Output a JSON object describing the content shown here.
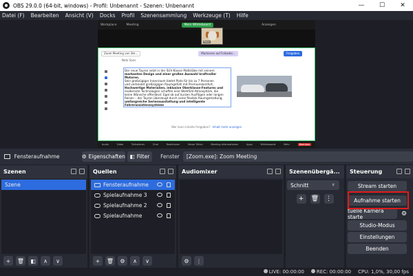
{
  "window": {
    "title": "OBS 29.0.0 (64-bit, windows) - Profil: Unbenannt - Szenen: Unbenannt",
    "minimize": "—",
    "maximize": "☐",
    "close": "✕"
  },
  "menu": [
    "Datei (F)",
    "Bearbeiten",
    "Ansicht (V)",
    "Docks",
    "Profil",
    "Szenensammlung",
    "Werkzeuge (T)",
    "Hilfe"
  ],
  "preview": {
    "zoom_tabs": [
      "Workplace",
      "Meeting",
      "Mein Whiteboard",
      "Anzeigen"
    ],
    "camera_name": "Peter",
    "whiteboard": {
      "title_input": "Zoom Meeting von Ste...",
      "follow_button": "Markieren auf Folkader...",
      "share_button": "Freigeben",
      "font": "Noto Sans",
      "text_lines": [
        "Der neue Tayron setzt in der SUV-Klasse Maßstäbe mit seinem",
        "markanten Design und einer großen Auswahl kraftvoller Motoren.",
        "Sein großzügiger Innenraum bietet Platz für bis zu 7 Personen",
        "und verbindet großzügigen Raumgefühl mit Premiumkomfort,",
        "Hochwertige Materialien, inklusive Oberklasse-Features und",
        "modernste Technologien schaffen eine Wohlfühl-Atmosphäre, die",
        "keine Wünsche offenlässt. Egal ob auf kurzen Ausflügen oder langen",
        "Reisen – der Tayron überzeugt durch seine flexible Raumgestaltung,",
        "umfangreiche Serienausstattung und intelligente",
        "Fahrerassistenzsysteme"
      ],
      "hint": "Wer kann Inhalte freigeben?",
      "hint_link": "Inhalt mehr anzeigen"
    },
    "zoom_controls": [
      "Audio",
      "Video",
      "Teilnehmer",
      "Chat",
      "Reaktionen",
      "Neuer Teilen",
      "Meeting-Informationen",
      "Apps",
      "Whiteboards",
      "Mehr",
      "Beenden"
    ]
  },
  "source_toolbar": {
    "name": "Fensteraufnahme",
    "properties": "Eigenschaften",
    "filter": "Filter",
    "window_label": "Fenster",
    "window_value": "[Zoom.exe]: Zoom Meeting"
  },
  "scenes": {
    "title": "Szenen",
    "items": [
      "Szene"
    ]
  },
  "sources": {
    "title": "Quellen",
    "items": [
      "Fensteraufnahme",
      "Spielaufnahme 3",
      "Spielaufnahme 2",
      "Spielaufnahme"
    ]
  },
  "mixer": {
    "title": "Audiomixer"
  },
  "transitions": {
    "title": "Szenenübergä...",
    "selected": "Schnitt"
  },
  "controls": {
    "title": "Steuerung",
    "stream": "Stream starten",
    "record": "Aufnahme starten",
    "vcam": "tuelle Kamera starte",
    "studio": "Studio-Modus",
    "settings": "Einstellungen",
    "exit": "Beenden"
  },
  "status": {
    "live": "LIVE: 00:00:00",
    "rec": "REC: 00:00:00",
    "cpu": "CPU: 1,0%, 30,00 fps"
  },
  "colors": {
    "accent": "#2d6cdf",
    "highlight": "#e21b1b",
    "panel": "#272a33",
    "bg": "#1e1f26"
  },
  "icons": {
    "plus": "+",
    "trash": "🗑",
    "filter": "◧",
    "up": "∧",
    "down": "∨",
    "gear": "⚙",
    "dots": "⋮"
  }
}
